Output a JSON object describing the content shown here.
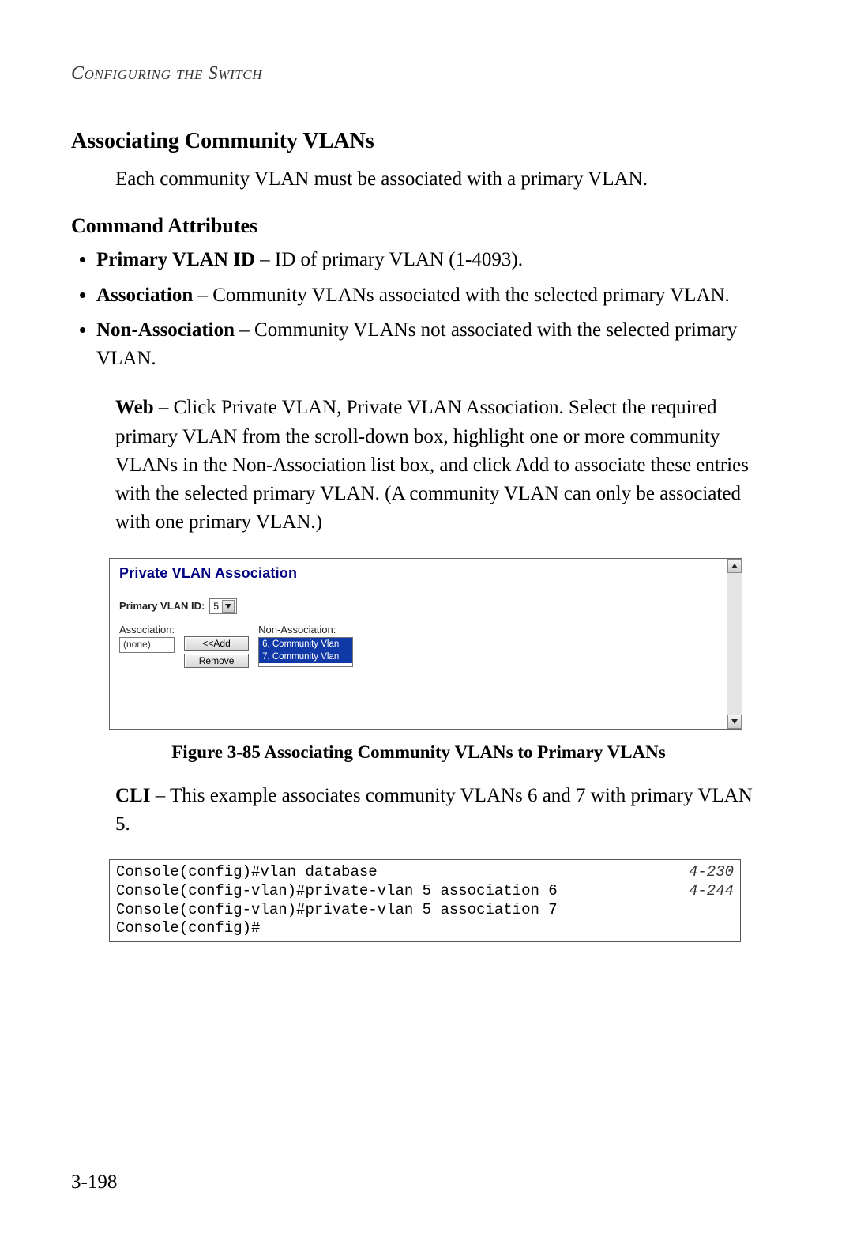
{
  "header": {
    "running": "Configuring the Switch"
  },
  "section": {
    "title": "Associating Community VLANs",
    "intro": "Each community VLAN must be associated with a primary VLAN."
  },
  "attrs": {
    "heading": "Command Attributes",
    "items": [
      {
        "term": "Primary VLAN ID",
        "desc": " – ID of primary VLAN (1-4093)."
      },
      {
        "term": "Association",
        "desc": " – Community VLANs associated with the selected primary VLAN."
      },
      {
        "term": "Non-Association",
        "desc": " – Community VLANs not associated with the selected primary VLAN."
      }
    ]
  },
  "web": {
    "label": "Web",
    "text": " – Click Private VLAN, Private VLAN Association. Select the required primary VLAN from the scroll-down box, highlight one or more community VLANs in the Non-Association list box, and click Add to associate these entries with the selected primary VLAN. (A community VLAN can only be associated with one primary VLAN.)"
  },
  "figure": {
    "panel_title": "Private VLAN Association",
    "pvid_label": "Primary VLAN ID:",
    "pvid_value": "5",
    "assoc_label": "Association:",
    "assoc_value": "(none)",
    "nonassoc_label": "Non-Association:",
    "nonassoc_options": [
      "6, Community Vlan",
      "7, Community Vlan"
    ],
    "btn_add": "<<Add",
    "btn_remove": "Remove",
    "caption": "Figure 3-85   Associating Community VLANs to Primary VLANs"
  },
  "cli": {
    "label": "CLI",
    "text": " – This example associates community VLANs 6 and 7 with primary VLAN 5.",
    "lines": [
      {
        "cmd": "Console(config)#vlan database",
        "ref": "4-230"
      },
      {
        "cmd": "Console(config-vlan)#private-vlan 5 association 6",
        "ref": "4-244"
      },
      {
        "cmd": "Console(config-vlan)#private-vlan 5 association 7",
        "ref": ""
      },
      {
        "cmd": "Console(config)#",
        "ref": ""
      }
    ]
  },
  "page_number": "3-198"
}
